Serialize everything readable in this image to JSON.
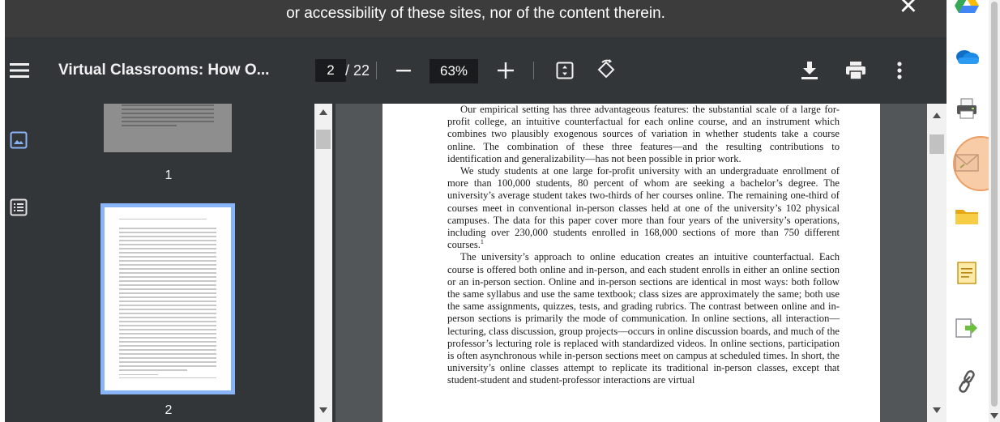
{
  "notice": {
    "text": "or accessibility of these sites, nor of the content therein.",
    "close_label": "×"
  },
  "toolbar": {
    "title": "Virtual Classrooms: How O...",
    "page_current": "2",
    "page_total": "/ 22",
    "zoom": "63%",
    "icons": [
      "menu-icon",
      "minus-icon",
      "plus-icon",
      "fit-page-icon",
      "rotate-icon",
      "download-icon",
      "print-icon",
      "more-vert-icon"
    ]
  },
  "sidebar": {
    "icons": [
      "thumbnail-view-icon",
      "outline-view-icon"
    ]
  },
  "thumbnails": [
    {
      "number": "1"
    },
    {
      "number": "2"
    }
  ],
  "document": {
    "paragraphs": [
      {
        "text": "Our empirical setting has three advantageous features: the substantial scale of a large for-profit college, an intuitive counterfactual for each online course, and an instrument which combines two plausibly exogenous sources of variation in whether students take a course online. The combination of these three features—and the resulting contributions to identification and generalizability—has not been possible in prior work.",
        "indent": true
      },
      {
        "text": "We study students at one large for-profit university with an undergraduate enrollment of more than 100,000 students, 80 percent of whom are seeking a bachelor’s degree. The university’s average student takes two-thirds of her courses online. The remaining one-third of courses meet in conventional in-person classes held at one of the university’s 102 physical campuses. The data for this paper cover more than four years of the university’s operations, including over 230,000 students enrolled in 168,000 sections of more than 750 different courses.",
        "footnote": "1",
        "indent": true
      },
      {
        "text": "The university’s approach to online education creates an intuitive counterfactual. Each course is offered both online and in-person, and each student enrolls in either an online section or an in-person section. Online and in-person sections are identical in most ways: both follow the same syllabus and use the same textbook; class sizes are approximately the same; both use the same assignments, quizzes, tests, and grading rubrics. The contrast between online and in-person sections is primarily the mode of communication. In online sections, all interaction—lecturing, class discussion, group projects—occurs in online discussion boards, and much of the professor’s lecturing role is replaced with standardized videos. In online sections, participation is often asynchronous while in-person sections meet on campus at scheduled times. In short, the university’s online classes attempt to replicate its traditional in-person classes, except that student-student and student-professor interactions are virtual",
        "indent": true
      }
    ]
  },
  "right_tools": [
    "google-drive-icon",
    "onedrive-icon",
    "printer-icon",
    "email-icon",
    "folder-icon",
    "note-icon",
    "export-icon",
    "link-icon"
  ],
  "colors": {
    "toolbar_bg": "#323639",
    "viewer_bg": "#525659",
    "highlight": "#f4a261",
    "thumb_selected_border": "#8ab4f8"
  }
}
